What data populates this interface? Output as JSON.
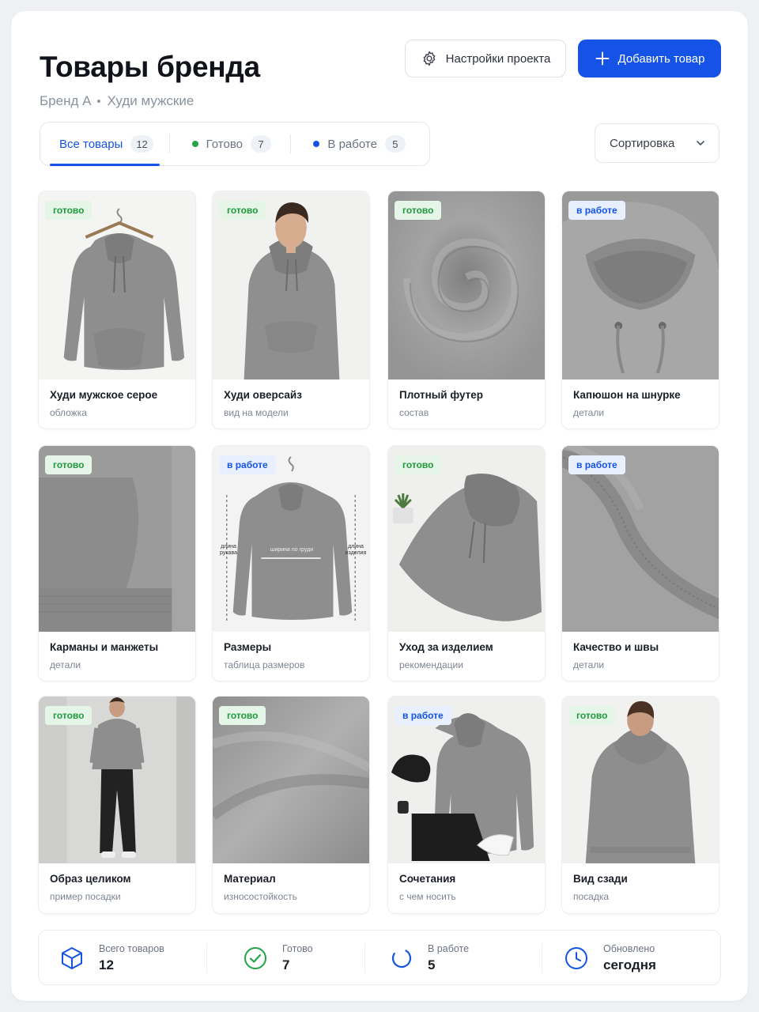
{
  "header": {
    "title": "Товары бренда",
    "breadcrumb": [
      "Бренд А",
      "Худи мужские"
    ],
    "settings_button": "Настройки проекта",
    "add_button": "Добавить товар"
  },
  "tabs": [
    {
      "label": "Все товары",
      "count": "12",
      "active": true
    },
    {
      "label": "Готово",
      "count": "7",
      "dot_color": "#22a447"
    },
    {
      "label": "В работе",
      "count": "5",
      "dot_color": "#1553e6"
    }
  ],
  "sort": {
    "label": "Сортировка"
  },
  "status_labels": {
    "ready": "готово",
    "work": "в работе"
  },
  "cards": [
    {
      "title": "Худи мужское серое",
      "subtitle": "обложка",
      "status": "готово",
      "image": "hoodie-on-hanger"
    },
    {
      "title": "Худи оверсайз",
      "subtitle": "вид на модели",
      "status": "готово",
      "image": "model-front"
    },
    {
      "title": "Плотный футер",
      "subtitle": "состав",
      "status": "готово",
      "image": "fabric-swirl"
    },
    {
      "title": "Капюшон на шнурке",
      "subtitle": "детали",
      "status": "в работе",
      "image": "hood-closeup"
    },
    {
      "title": "Карманы и манжеты",
      "subtitle": "детали",
      "status": "готово",
      "image": "pocket-closeup"
    },
    {
      "title": "Размеры",
      "subtitle": "таблица размеров",
      "status": "в работе",
      "image": "size-chart",
      "size_labels": {
        "sleeve": "длина рукава",
        "chest": "ширина по груди",
        "length": "длина изделия"
      }
    },
    {
      "title": "Уход за изделием",
      "subtitle": "рекомендации",
      "status": "готово",
      "image": "folded-hoodie"
    },
    {
      "title": "Качество и швы",
      "subtitle": "детали",
      "status": "в работе",
      "image": "seam-closeup"
    },
    {
      "title": "Образ целиком",
      "subtitle": "пример посадки",
      "status": "готово",
      "image": "full-look"
    },
    {
      "title": "Материал",
      "subtitle": "износостойкость",
      "status": "готово",
      "image": "fabric-texture"
    },
    {
      "title": "Сочетания",
      "subtitle": "с чем носить",
      "status": "в работе",
      "image": "outfit-flatlay"
    },
    {
      "title": "Вид сзади",
      "subtitle": "посадка",
      "status": "готово",
      "image": "back-view"
    }
  ],
  "stats": [
    {
      "label": "Всего товаров",
      "value": "12",
      "icon": "box-icon",
      "color": "#1553e6"
    },
    {
      "label": "Готово",
      "value": "7",
      "icon": "check-circle-icon",
      "color": "#22a447"
    },
    {
      "label": "В работе",
      "value": "5",
      "icon": "progress-icon",
      "color": "#1553e6"
    },
    {
      "label": "Обновлено",
      "value": "сегодня",
      "icon": "clock-icon",
      "color": "#1553e6"
    }
  ]
}
